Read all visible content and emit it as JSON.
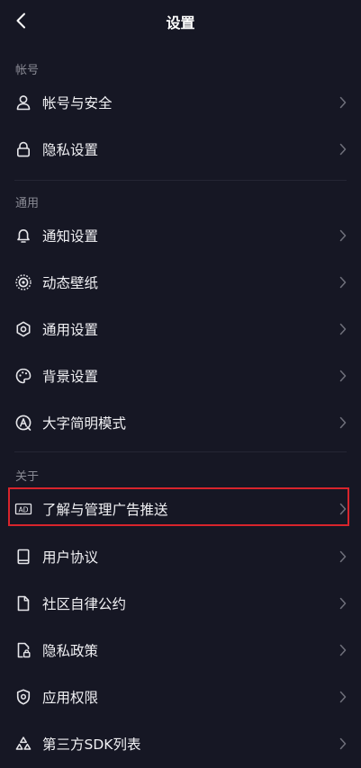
{
  "header": {
    "title": "设置"
  },
  "sections": {
    "account": {
      "label": "帐号"
    },
    "general": {
      "label": "通用"
    },
    "about": {
      "label": "关于"
    }
  },
  "items": {
    "account_security": "帐号与安全",
    "privacy_settings": "隐私设置",
    "notification_settings": "通知设置",
    "live_wallpaper": "动态壁纸",
    "general_settings": "通用设置",
    "background_settings": "背景设置",
    "large_text_mode": "大字简明模式",
    "ad_push": "了解与管理广告推送",
    "user_agreement": "用户协议",
    "community_guidelines": "社区自律公约",
    "privacy_policy": "隐私政策",
    "app_permissions": "应用权限",
    "third_party_sdk": "第三方SDK列表"
  },
  "ad_badge": "AD",
  "colors": {
    "background": "#161724",
    "highlight_border": "#d8242c",
    "section_label": "#8a8b95"
  }
}
